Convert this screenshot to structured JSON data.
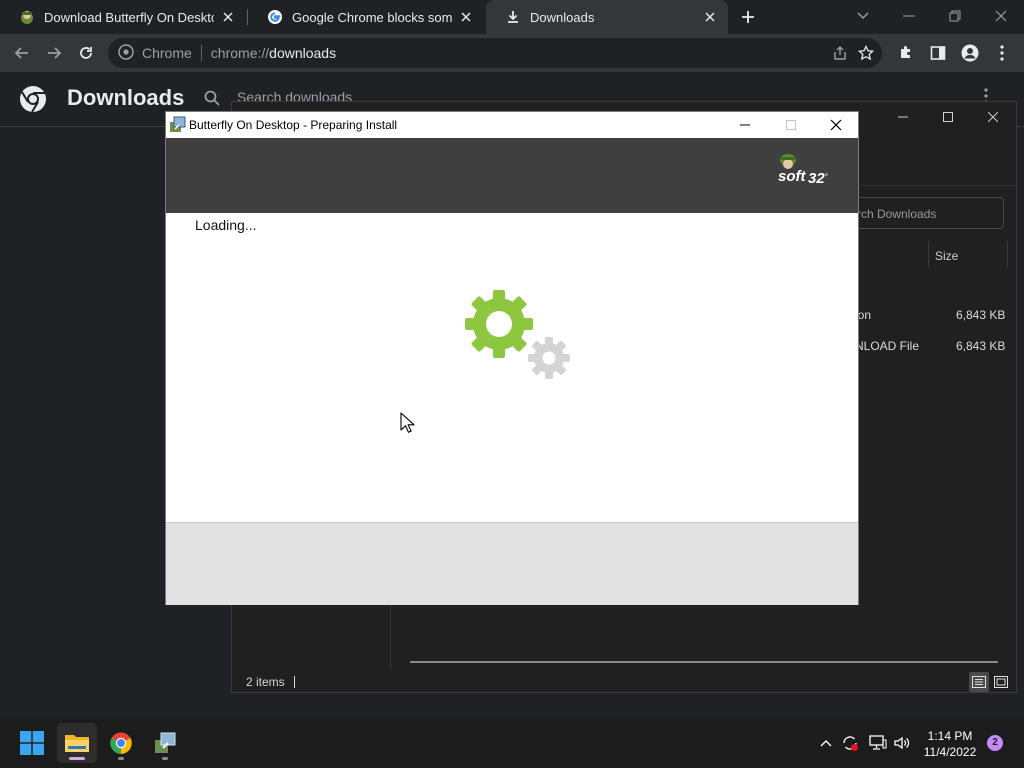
{
  "browser": {
    "tabs": [
      {
        "title": "Download Butterfly On Desktop",
        "favicon": "soft32-icon",
        "active": false
      },
      {
        "title": "Google Chrome blocks some do",
        "favicon": "google-icon",
        "active": false
      },
      {
        "title": "Downloads",
        "favicon": "download-icon",
        "active": true
      }
    ],
    "address": {
      "origin": "Chrome",
      "url_prefix": "chrome://",
      "url_path": "downloads"
    }
  },
  "downloads_page": {
    "title": "Downloads",
    "search_placeholder": "Search downloads"
  },
  "explorer": {
    "search_placeholder": "rch Downloads",
    "columns": {
      "size": "Size"
    },
    "rows": [
      {
        "type": "ion",
        "size": "6,843 KB"
      },
      {
        "type": "NLOAD File",
        "size": "6,843 KB"
      }
    ],
    "status": "2 items"
  },
  "dialog": {
    "title": "Butterfly On Desktop - Preparing Install",
    "loading_text": "Loading...",
    "brand_colors": {
      "banner": "#3f3f3f",
      "gear_green": "#8dc63f",
      "gear_gray": "#d4d4d4"
    }
  },
  "taskbar": {
    "time": "1:14 PM",
    "date": "11/4/2022",
    "notification_count": "2"
  }
}
